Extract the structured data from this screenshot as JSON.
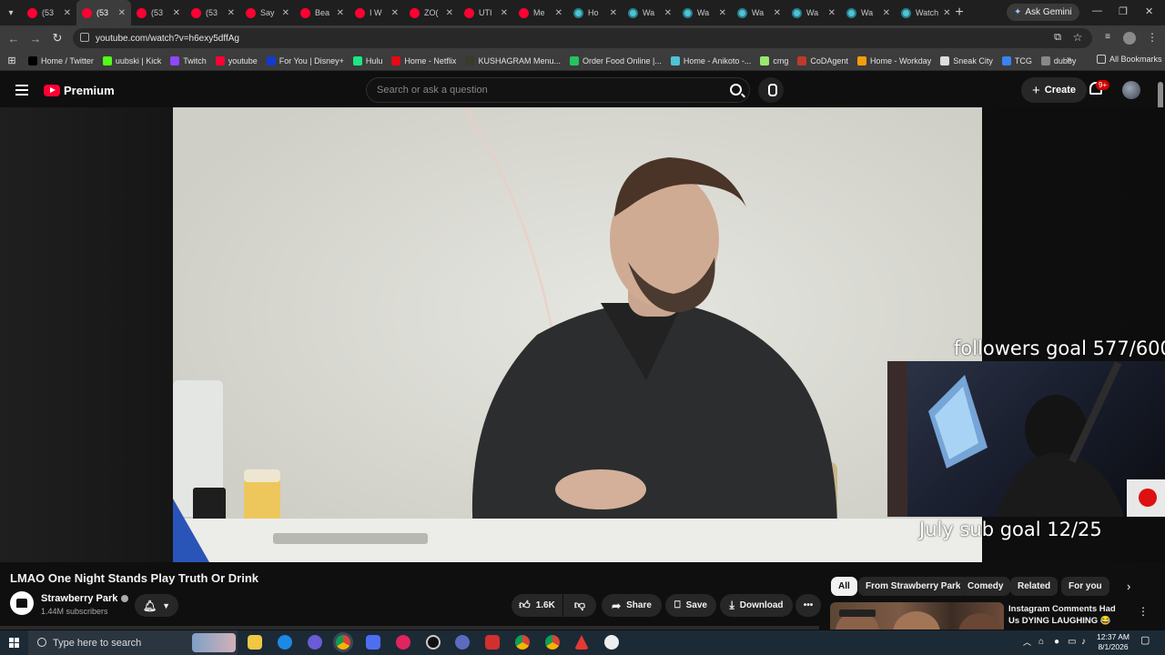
{
  "browser": {
    "tabs": [
      {
        "label": "(53",
        "type": "yt"
      },
      {
        "label": "(53",
        "type": "yt",
        "active": true
      },
      {
        "label": "(53",
        "type": "yt"
      },
      {
        "label": "(53",
        "type": "yt"
      },
      {
        "label": "Say",
        "type": "yt"
      },
      {
        "label": "Bea",
        "type": "yt"
      },
      {
        "label": "I W",
        "type": "yt"
      },
      {
        "label": "ZO(",
        "type": "yt"
      },
      {
        "label": "UTI",
        "type": "yt"
      },
      {
        "label": "Me",
        "type": "yt"
      },
      {
        "label": "Ho",
        "type": "web"
      },
      {
        "label": "Wa",
        "type": "web"
      },
      {
        "label": "Wa",
        "type": "web"
      },
      {
        "label": "Wa",
        "type": "web"
      },
      {
        "label": "Wa",
        "type": "web"
      },
      {
        "label": "Wa",
        "type": "web"
      },
      {
        "label": "Watch",
        "type": "web"
      }
    ],
    "ask_gemini": "Ask Gemini",
    "url": "youtube.com/watch?v=h6exy5dffAg",
    "bookmarks": [
      {
        "label": "Home / Twitter",
        "color": "#000000"
      },
      {
        "label": "uubski | Kick",
        "color": "#53fc18"
      },
      {
        "label": "Twitch",
        "color": "#9146ff"
      },
      {
        "label": "youtube",
        "color": "#ff0033"
      },
      {
        "label": "For You | Disney+",
        "color": "#113ccf"
      },
      {
        "label": "Hulu",
        "color": "#1ce783"
      },
      {
        "label": "Home - Netflix",
        "color": "#e50914"
      },
      {
        "label": "KUSHAGRAM Menu...",
        "color": "#3a3a2a"
      },
      {
        "label": "Order Food Online |...",
        "color": "#22c55e"
      },
      {
        "label": "Home - Anikoto -...",
        "color": "#4fc3d4"
      },
      {
        "label": "cmg",
        "color": "#9ae66e"
      },
      {
        "label": "CoDAgent",
        "color": "#c0392b"
      },
      {
        "label": "Home - Workday",
        "color": "#f59e0b"
      },
      {
        "label": "Sneak City",
        "color": "#dddddd"
      },
      {
        "label": "TCG",
        "color": "#3b82f6"
      },
      {
        "label": "dubby",
        "color": "#888888"
      }
    ],
    "all_bookmarks": "All Bookmarks"
  },
  "youtube": {
    "logo_text": "Premium",
    "search_placeholder": "Search or ask a question",
    "create_label": "Create",
    "notification_badge": "9+",
    "overlay_followers": "followers goal 577/600",
    "overlay_subs": "July sub goal 12/25",
    "video_title": "LMAO One Night Stands Play Truth Or Drink",
    "channel_name": "Strawberry Park",
    "subscribers": "1.44M subscribers",
    "like_count": "1.6K",
    "share_label": "Share",
    "save_label": "Save",
    "download_label": "Download",
    "chips": [
      "All",
      "From Strawberry Park",
      "Comedy",
      "Related",
      "For you"
    ],
    "suggested_title": "Instagram Comments Had Us DYING LAUGHING 😂"
  },
  "taskbar": {
    "search_placeholder": "Type here to search",
    "time": "12:37 AM",
    "date": "8/1/2026"
  }
}
